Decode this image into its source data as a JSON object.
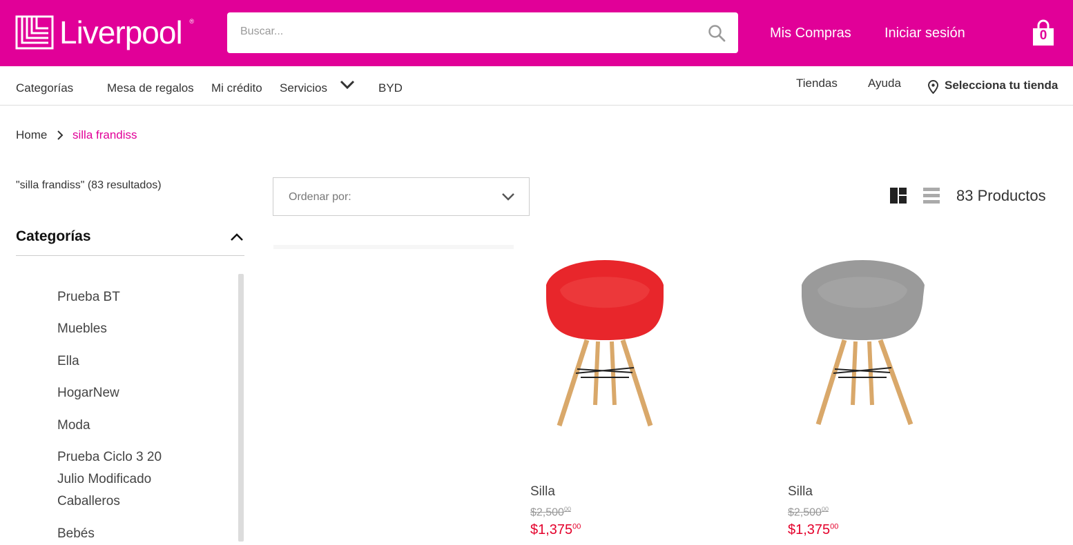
{
  "brand": {
    "name": "Liverpool",
    "reg": "®",
    "color": "#e10098"
  },
  "search": {
    "placeholder": "Buscar..."
  },
  "header": {
    "mis_compras": "Mis Compras",
    "iniciar_sesion": "Iniciar sesión",
    "cart_count": "0"
  },
  "nav": {
    "categorias": "Categorías",
    "mesa": "Mesa de regalos",
    "credito": "Mi crédito",
    "servicios": "Servicios",
    "byd": "BYD",
    "tiendas": "Tiendas",
    "ayuda": "Ayuda",
    "store": "Selecciona tu tienda"
  },
  "breadcrumb": {
    "home": "Home",
    "current": "silla frandiss"
  },
  "results_text": "\"silla frandiss\" (83 resultados)",
  "sort": {
    "label": "Ordenar por:"
  },
  "product_count": "83 Productos",
  "sidebar": {
    "title": "Categorías",
    "items": [
      {
        "label": "Prueba BT"
      },
      {
        "label": "Muebles"
      },
      {
        "label": "Ella"
      },
      {
        "label": "HogarNew"
      },
      {
        "label": "Moda"
      },
      {
        "label": "Prueba Ciclo 3 20"
      },
      {
        "label": "Julio Modificado"
      },
      {
        "label": "Caballeros"
      },
      {
        "label": "Bebés"
      }
    ]
  },
  "products": [
    {
      "name": "Silla",
      "old_price": "$2,500",
      "old_cents": "00",
      "price": "$1,375",
      "cents": "00",
      "color": "#e8262b"
    },
    {
      "name": "Silla",
      "old_price": "$2,500",
      "old_cents": "00",
      "price": "$1,375",
      "cents": "00",
      "color": "#9a9a9a"
    }
  ]
}
